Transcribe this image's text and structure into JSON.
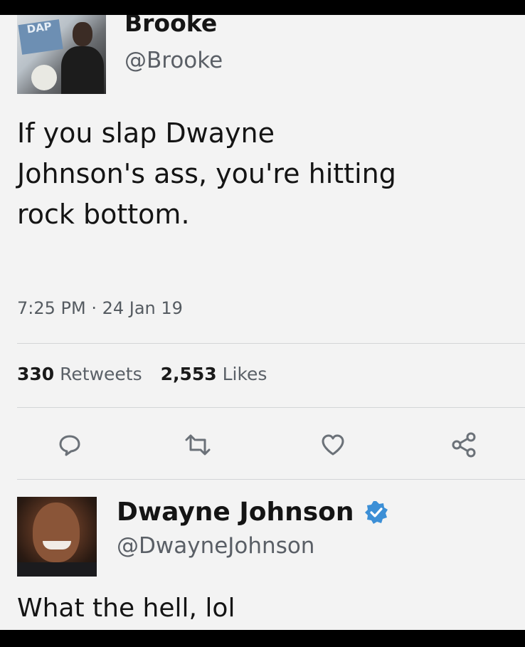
{
  "tweet": {
    "author": {
      "name": "Brooke",
      "handle": "@Brooke",
      "avatar_text": "DAP"
    },
    "text": "If you slap Dwayne\nJohnson's ass, you're hitting\nrock bottom.",
    "timestamp": "7:25 PM · 24 Jan 19",
    "stats": {
      "retweets_count": "330",
      "retweets_label": "Retweets",
      "likes_count": "2,553",
      "likes_label": "Likes"
    },
    "actions": [
      {
        "name": "reply-icon"
      },
      {
        "name": "retweet-icon"
      },
      {
        "name": "like-icon"
      },
      {
        "name": "share-icon"
      }
    ]
  },
  "reply": {
    "author": {
      "name": "Dwayne Johnson",
      "handle": "@DwayneJohnson",
      "verified": true,
      "verified_icon": "verified-badge-icon"
    },
    "text": "What the hell, lol"
  },
  "colors": {
    "background": "#f3f3f3",
    "text": "#141414",
    "muted": "#5a5f66",
    "verified": "#3c8fd6"
  }
}
